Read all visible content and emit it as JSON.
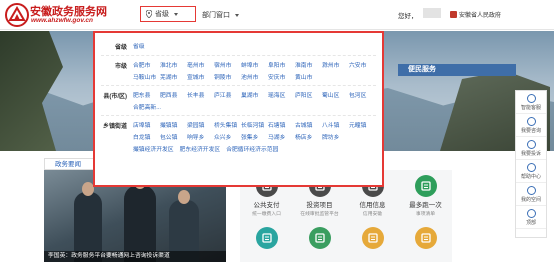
{
  "header": {
    "site_title": "安徽政务服务网",
    "site_url": "www.ahzwfw.gov.cn",
    "region_label": "省级",
    "dept_label": "部门窗口",
    "greeting": "您好，",
    "citizen_label": "安徽省人民政府"
  },
  "banner": {
    "service_heading": "便民服务"
  },
  "dropdown": {
    "rows": [
      {
        "label": "省级",
        "items": [
          "省级"
        ]
      },
      {
        "label": "市级",
        "items": [
          "合肥市",
          "淮北市",
          "亳州市",
          "宿州市",
          "蚌埠市",
          "阜阳市",
          "淮南市",
          "滁州市",
          "六安市",
          "马鞍山市",
          "芜湖市",
          "宣城市",
          "铜陵市",
          "池州市",
          "安庆市",
          "黄山市"
        ]
      },
      {
        "label": "县(市/区)",
        "items": [
          "肥东县",
          "肥西县",
          "长丰县",
          "庐江县",
          "巢湖市",
          "瑶海区",
          "庐阳区",
          "蜀山区",
          "包河区",
          "合肥高新..."
        ]
      },
      {
        "label": "乡镇街道",
        "items": [
          "店埠镇",
          "撮镇镇",
          "梁园镇",
          "桥头集镇",
          "长临河镇",
          "石塘镇",
          "古城镇",
          "八斗镇",
          "元疃镇",
          "白龙镇",
          "包公镇",
          "响导乡",
          "众兴乡",
          "张集乡",
          "马湖乡",
          "杨店乡",
          "牌坊乡",
          "撮镇经济开发区",
          "肥东经济开发区",
          "合肥循环经济示范园"
        ]
      }
    ]
  },
  "section": {
    "tab_label": "政务要闻"
  },
  "photo": {
    "caption": "李国英：政务服务平台要畅通网上咨询投诉渠道"
  },
  "services": [
    {
      "title": "公共支付",
      "sub": "统一缴费入口",
      "color": "#4a4a4a"
    },
    {
      "title": "投资项目",
      "sub": "在线审批监管平台",
      "color": "#4a4a4a"
    },
    {
      "title": "信用信息",
      "sub": "信用安徽",
      "color": "#4a4a4a"
    },
    {
      "title": "最多跑一次",
      "sub": "事项清单",
      "color": "#2e9e5b"
    },
    {
      "title": "",
      "sub": "",
      "color": "#2aa5a0"
    },
    {
      "title": "",
      "sub": "",
      "color": "#3a9e60"
    },
    {
      "title": "",
      "sub": "",
      "color": "#e6a93a"
    },
    {
      "title": "",
      "sub": "",
      "color": "#e6a93a"
    }
  ],
  "rail": {
    "top_label": "",
    "items": [
      {
        "label": "智能客服"
      },
      {
        "label": "我要咨询"
      },
      {
        "label": "我要投诉"
      },
      {
        "label": "帮助中心"
      },
      {
        "label": "我的空间"
      },
      {
        "label": "顶部"
      }
    ]
  },
  "colors": {
    "accent": "#e53935",
    "brand": "#c81d1d",
    "link": "#2a62b8",
    "service_bar": "#3f6ea8"
  }
}
